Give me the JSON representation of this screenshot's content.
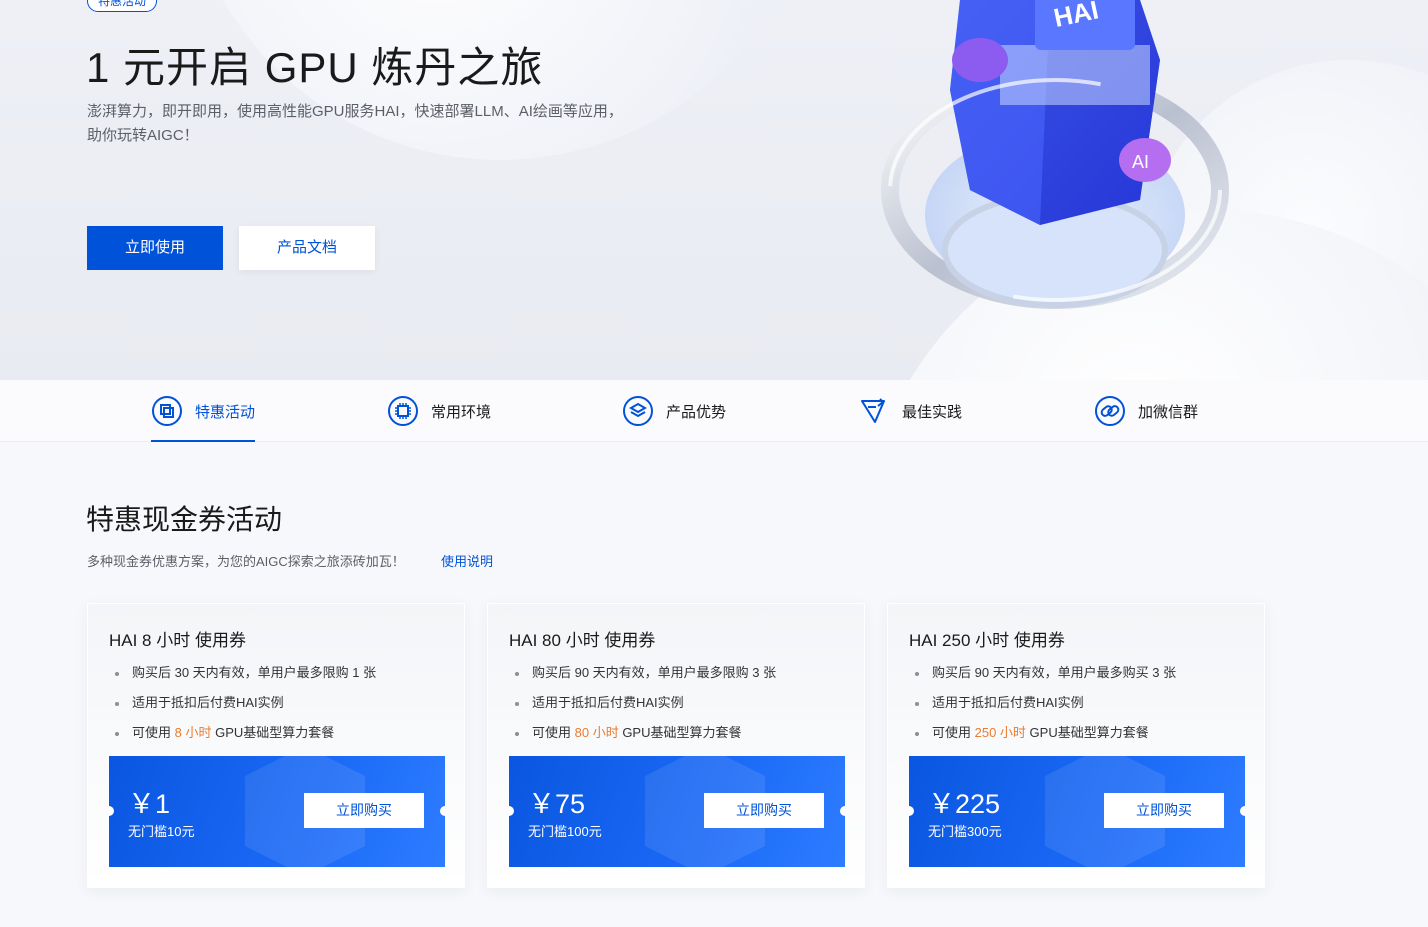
{
  "hero": {
    "tag": "特惠活动",
    "title": "1 元开启 GPU 炼丹之旅",
    "desc_line1": "澎湃算力，即开即用，使用高性能GPU服务HAI，快速部署LLM、AI绘画等应用，",
    "desc_line2": "助你玩转AIGC！",
    "primary_btn": "立即使用",
    "secondary_btn": "产品文档",
    "illustration_chip_label": "HAI",
    "illustration_badge_label": "AI"
  },
  "tabs": [
    {
      "label": "特惠活动",
      "icon": "coupon-icon",
      "active": true
    },
    {
      "label": "常用环境",
      "icon": "chip-icon",
      "active": false
    },
    {
      "label": "产品优势",
      "icon": "layers-icon",
      "active": false
    },
    {
      "label": "最佳实践",
      "icon": "flag-icon",
      "active": false
    },
    {
      "label": "加微信群",
      "icon": "link-icon",
      "active": false
    }
  ],
  "section": {
    "title": "特惠现金券活动",
    "desc": "多种现金券优惠方案，为您的AIGC探索之旅添砖加瓦！",
    "link": "使用说明"
  },
  "cards": [
    {
      "title": "HAI 8 小时 使用券",
      "item1": "购买后 30 天内有效，单用户最多限购 1 张",
      "item2": "适用于抵扣后付费HAI实例",
      "item3_pre": "可使用 ",
      "item3_hl": "8 小时",
      "item3_post": " GPU基础型算力套餐",
      "price": "￥1",
      "condition": "无门槛10元",
      "buy": "立即购买"
    },
    {
      "title": "HAI 80 小时 使用券",
      "item1": "购买后 90 天内有效，单用户最多限购 3 张",
      "item2": "适用于抵扣后付费HAI实例",
      "item3_pre": "可使用 ",
      "item3_hl": "80 小时",
      "item3_post": " GPU基础型算力套餐",
      "price": "￥75",
      "condition": "无门槛100元",
      "buy": "立即购买"
    },
    {
      "title": "HAI 250 小时 使用券",
      "item1": "购买后 90 天内有效，单用户最多购买 3 张",
      "item2": "适用于抵扣后付费HAI实例",
      "item3_pre": "可使用 ",
      "item3_hl": "250 小时",
      "item3_post": " GPU基础型算力套餐",
      "price": "￥225",
      "condition": "无门槛300元",
      "buy": "立即购买"
    }
  ],
  "colors": {
    "brand": "#0052d9",
    "highlight": "#ed7b2f",
    "coupon_bg": "#0a56e0"
  }
}
